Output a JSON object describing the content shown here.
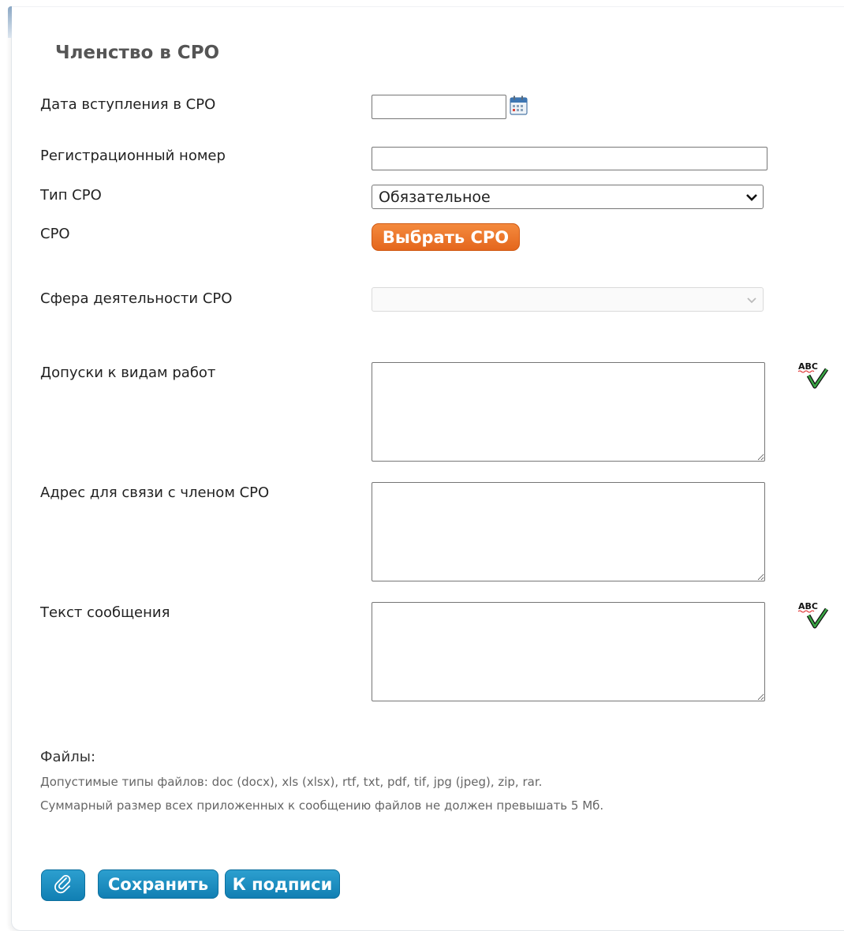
{
  "form": {
    "title": "Членство в СРО",
    "fields": {
      "join_date_label": "Дата вступления в СРО",
      "join_date_value": "",
      "reg_number_label": "Регистрационный номер",
      "reg_number_value": "",
      "sro_type_label": "Тип СРО",
      "sro_type_value": "Обязательное",
      "sro_label": "СРО",
      "select_sro_button": "Выбрать СРО",
      "activity_label": "Сфера деятельности СРО",
      "activity_value": "",
      "permits_label": "Допуски к видам работ",
      "permits_value": "",
      "address_label": "Адрес для связи с членом СРО",
      "address_value": "",
      "message_label": "Текст сообщения",
      "message_value": ""
    },
    "files": {
      "title": "Файлы:",
      "allowed_types": "Допустимые типы файлов: doc (docx), xls (xlsx), rtf, txt, pdf, tif, jpg (jpeg), zip, rar.",
      "size_limit": "Суммарный размер всех приложенных к сообщению файлов не должен превышать 5 Мб."
    },
    "actions": {
      "attach_icon": "paperclip-icon",
      "save": "Сохранить",
      "to_sign": "К подписи"
    },
    "spellcheck_icon_text": "ABC"
  },
  "colors": {
    "orange_button": "#e4661d",
    "blue_button": "#117fb3",
    "title_text": "#555555"
  }
}
